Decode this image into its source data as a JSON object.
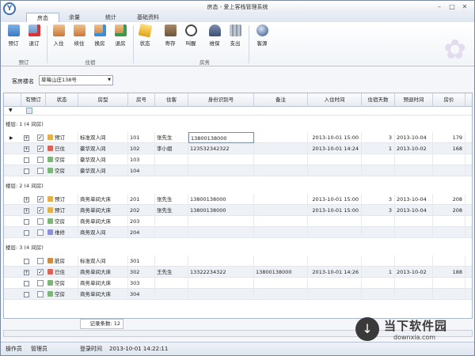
{
  "window": {
    "title": "房态 - 爱上客栈管理系统",
    "logo": "Y",
    "minimize": "–",
    "maximize": "□",
    "close": "✕"
  },
  "tabs": [
    "房态",
    "余量",
    "统计",
    "基础资料"
  ],
  "ribbon": {
    "buttons": [
      "预订",
      "退订",
      "入住",
      "续住",
      "换房",
      "退房",
      "状态",
      "寄存",
      "叫醒",
      "维保",
      "支出",
      "客源"
    ],
    "groups": [
      "预订",
      "住宿",
      "房务"
    ]
  },
  "filter": {
    "label": "客房楼名",
    "value": "草莓山庄138号"
  },
  "grid": {
    "columns": [
      "有预订",
      "状态",
      "房型",
      "房号",
      "住客",
      "身份识别号",
      "备注",
      "入住时间",
      "住宿天数",
      "预退时间",
      "房价"
    ],
    "groups": [
      "楼层: 1  (4 间房)",
      "楼层: 2  (4 间房)",
      "楼层: 3  (4 间房)"
    ],
    "rows": [
      {
        "status": "预订",
        "type": "标准双人间",
        "room": "101",
        "guest": "张先生",
        "id": "13800138000",
        "note": "",
        "checkin": "2013-10-01 15:00",
        "days": "3",
        "checkout": "2013-10-04",
        "price": "179"
      },
      {
        "status": "已住",
        "type": "豪华双人间",
        "room": "102",
        "guest": "李小姐",
        "id": "123532342322",
        "note": "",
        "checkin": "2013-10-01 14:24",
        "days": "1",
        "checkout": "2013-10-02",
        "price": "168"
      },
      {
        "status": "空房",
        "type": "豪华双人间",
        "room": "103",
        "guest": "",
        "id": "",
        "note": "",
        "checkin": "",
        "days": "",
        "checkout": "",
        "price": ""
      },
      {
        "status": "空房",
        "type": "豪华双人间",
        "room": "104",
        "guest": "",
        "id": "",
        "note": "",
        "checkin": "",
        "days": "",
        "checkout": "",
        "price": ""
      },
      {
        "status": "预订",
        "type": "商务单间大床",
        "room": "201",
        "guest": "张先生",
        "id": "13800138000",
        "note": "",
        "checkin": "2013-10-01 15:00",
        "days": "3",
        "checkout": "2013-10-04",
        "price": "208"
      },
      {
        "status": "预订",
        "type": "商务单间大床",
        "room": "202",
        "guest": "张先生",
        "id": "13800138000",
        "note": "",
        "checkin": "2013-10-01 15:00",
        "days": "3",
        "checkout": "2013-10-04",
        "price": "208"
      },
      {
        "status": "空房",
        "type": "商务单间大床",
        "room": "203",
        "guest": "",
        "id": "",
        "note": "",
        "checkin": "",
        "days": "",
        "checkout": "",
        "price": ""
      },
      {
        "status": "维修",
        "type": "商务双人间",
        "room": "204",
        "guest": "",
        "id": "",
        "note": "",
        "checkin": "",
        "days": "",
        "checkout": "",
        "price": ""
      },
      {
        "status": "脏房",
        "type": "标准双人间",
        "room": "301",
        "guest": "",
        "id": "",
        "note": "",
        "checkin": "",
        "days": "",
        "checkout": "",
        "price": ""
      },
      {
        "status": "已住",
        "type": "商务单间大床",
        "room": "302",
        "guest": "王先生",
        "id": "13322234322",
        "note": "13800138000",
        "checkin": "2013-10-01 14:26",
        "days": "1",
        "checkout": "2013-10-02",
        "price": "188"
      },
      {
        "status": "空房",
        "type": "商务单间大床",
        "room": "303",
        "guest": "",
        "id": "",
        "note": "",
        "checkin": "",
        "days": "",
        "checkout": "",
        "price": ""
      },
      {
        "status": "空房",
        "type": "商务单间大床",
        "room": "304",
        "guest": "",
        "id": "",
        "note": "",
        "checkin": "",
        "days": "",
        "checkout": "",
        "price": ""
      }
    ],
    "summary": "记录条数: 12"
  },
  "statusbar": {
    "operator_label": "操作员",
    "operator": "管理员",
    "login_label": "登录时间",
    "login_time": "2013-10-01 14:22:11"
  },
  "watermark": {
    "name": "当下软件园",
    "url": "downxia.com",
    "icon": "↓"
  }
}
